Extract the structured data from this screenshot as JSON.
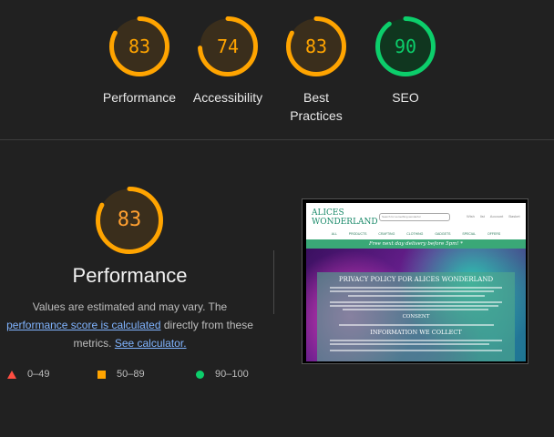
{
  "scores": [
    {
      "value": "83",
      "label": "Performance",
      "color": "#ffa400",
      "fraction": 0.83
    },
    {
      "value": "74",
      "label": "Accessibility",
      "color": "#ffa400",
      "fraction": 0.74
    },
    {
      "value": "83",
      "label": "Best Practices",
      "color": "#ffa400",
      "fraction": 0.83
    },
    {
      "value": "90",
      "label": "SEO",
      "color": "#0cce6b",
      "fraction": 0.9
    }
  ],
  "performance": {
    "score": "83",
    "fraction": 0.83,
    "title": "Performance",
    "desc_pre": "Values are estimated and may vary. The",
    "link1": "performance score is calculated",
    "desc_mid": "directly from these metrics.",
    "link2": "See calculator."
  },
  "legend": [
    {
      "range": "0–49",
      "color": "#ff4e42",
      "shape": "triangle"
    },
    {
      "range": "50–89",
      "color": "#ffa400",
      "shape": "square"
    },
    {
      "range": "90–100",
      "color": "#0cce6b",
      "shape": "circle"
    }
  ],
  "screenshot": {
    "logo_line1": "ALICES",
    "logo_line2": "WONDERLAND",
    "search_placeholder": "Search for something wonderful",
    "header_icons": "Wish list Account Basket",
    "nav": "ALL PRODUCTS CRAFTING CLOTHING GADGETS SPECIAL OFFERS",
    "banner": "Free next day delivery before 5pm! *",
    "hero_title": "PRIVACY POLICY FOR ALICES WONDERLAND",
    "heading_consent": "CONSENT",
    "heading_info": "INFORMATION WE COLLECT"
  }
}
